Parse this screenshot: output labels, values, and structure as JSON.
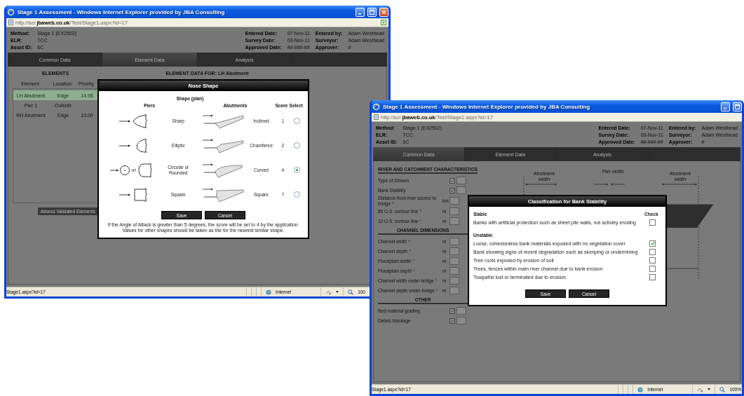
{
  "windows": [
    {
      "title": "Stage 1 Assessment - Windows Internet Explorer provided by JBA Consulting",
      "address": "http://scr.**jbaweb.co.uk**/Test/Stage1.aspx?id=17",
      "info_left": [
        {
          "label": "Method:",
          "value": "Stage 1 (EX2502)"
        },
        {
          "label": "ELR:",
          "value": "TCC"
        },
        {
          "label": "Asset ID:",
          "value": "6C"
        }
      ],
      "info_right": [
        {
          "label": "Entered Date:",
          "value": "07-Nov-11"
        },
        {
          "label": "Entered by:",
          "value": "Adam Westhead"
        },
        {
          "label": "Survey Date:",
          "value": "03-Nov-11"
        },
        {
          "label": "Surveyor:",
          "value": "Adam Westhead"
        },
        {
          "label": "Approved Date:",
          "value": "##-###-##"
        },
        {
          "label": "Approver:",
          "value": "#"
        }
      ],
      "tabs": [
        {
          "label": "Common Data",
          "selected": false
        },
        {
          "label": "Element Data",
          "selected": true
        },
        {
          "label": "Analysis",
          "selected": false
        }
      ],
      "kind": "elements",
      "elements": {
        "title": "ELEMENTS",
        "columns": [
          "Element",
          "Location",
          "Priority"
        ],
        "rows": [
          {
            "cells": [
              "LH Abutment",
              "Edge",
              "14.95"
            ],
            "selected": true
          },
          {
            "cells": [
              "Pier 1",
              "Outside"
            ],
            "selected": false
          },
          {
            "cells": [
              "RH Abutment",
              "Edge",
              "10.00"
            ],
            "selected": false
          }
        ],
        "button": "Assess Validated Elements"
      },
      "data_title": "ELEMENT DATA FOR:  LH Abutment",
      "dialog": {
        "kind": "nose_shape",
        "title": "Nose Shape",
        "heading": "Shape (plan)",
        "columns": [
          "Piers",
          "Abutments",
          "Score",
          "Select"
        ],
        "rows": [
          {
            "pier": {
              "kind": "sharp",
              "name": "Sharp"
            },
            "abutment": {
              "kind": "inclined",
              "name": "Inclined"
            },
            "score": "1",
            "selected": false
          },
          {
            "pier": {
              "kind": "elliptic",
              "name": "Elliptic"
            },
            "abutment": {
              "kind": "chamfered",
              "name": "Chamfered"
            },
            "score": "2",
            "selected": false
          },
          {
            "pier": {
              "kind": "circular",
              "name": "Circular or Rounded",
              "alt": "or"
            },
            "abutment": {
              "kind": "curved",
              "name": "Curved"
            },
            "score": "4",
            "selected": true
          },
          {
            "pier": {
              "kind": "square",
              "name": "Square"
            },
            "abutment": {
              "kind": "square",
              "name": "Square"
            },
            "score": "7",
            "selected": false
          }
        ],
        "buttons": [
          "Save",
          "Cancel"
        ],
        "notes": [
          "If the Angle of Attack is greater than 5 degrees, the score will be set to 4 by the application.",
          "Values for other shapes should be taken as the for the nearest similar shape."
        ]
      },
      "status": {
        "text": "Stage1.aspx?id=17",
        "zone": "Internet",
        "zoom": "100"
      }
    },
    {
      "title": "Stage 1 Assessment - Windows Internet Explorer provided by JBA Consulting",
      "address": "http://scr.**jbaweb.co.uk**/Test/Stage1.aspx?id=17",
      "info_left": [
        {
          "label": "Method:",
          "value": "Stage 1 (EX2502)"
        },
        {
          "label": "ELR:",
          "value": "TCC"
        },
        {
          "label": "Asset ID:",
          "value": "6C"
        }
      ],
      "info_right": [
        {
          "label": "Entered Date:",
          "value": "07-Nov-11"
        },
        {
          "label": "Entered by:",
          "value": "Adam Westhead"
        },
        {
          "label": "Survey Date:",
          "value": "03-Nov-11"
        },
        {
          "label": "Surveyor:",
          "value": "Adam Westhead"
        },
        {
          "label": "Approved Date:",
          "value": "##-###-##"
        },
        {
          "label": "Approver:",
          "value": "#"
        }
      ],
      "tabs": [
        {
          "label": "Common Data",
          "selected": true
        },
        {
          "label": "Element Data",
          "selected": false
        },
        {
          "label": "Analysis",
          "selected": false
        }
      ],
      "kind": "common",
      "sections": [
        {
          "heading": "RIVER AND CATCHMENT CHARACTERISTICS",
          "fields": [
            {
              "label": "Type of Stream",
              "kind": "select"
            },
            {
              "label": "Bank Stability",
              "kind": "select"
            },
            {
              "label": "Distance from river source to bridge",
              "required_mark": "*",
              "unit": "km",
              "kind": "number"
            },
            {
              "label": "85 O.S. contour line",
              "required_mark": "*",
              "unit": "m",
              "kind": "number"
            },
            {
              "label": "10 O.S. contour line",
              "required_mark": "*",
              "unit": "m",
              "kind": "number"
            }
          ]
        },
        {
          "heading": "CHANNEL DIMENSIONS",
          "fields": [
            {
              "label": "Channel width",
              "required_mark": "*",
              "unit": "m",
              "kind": "number"
            },
            {
              "label": "Channel depth",
              "required_mark": "*",
              "unit": "m",
              "kind": "number"
            },
            {
              "label": "Floodplain width",
              "required_mark": "*",
              "unit": "m",
              "kind": "number"
            },
            {
              "label": "Floodplain depth",
              "required_mark": "*",
              "unit": "m",
              "kind": "number"
            },
            {
              "label": "Channel width under bridge",
              "required_mark": "*",
              "unit": "m",
              "kind": "number"
            },
            {
              "label": "Channel depth under bridge",
              "required_mark": "*",
              "unit": "m",
              "kind": "number"
            }
          ]
        },
        {
          "heading": "OTHER",
          "fields": [
            {
              "label": "Bed material grading",
              "kind": "select"
            },
            {
              "label": "Debris blockage",
              "kind": "select"
            }
          ]
        }
      ],
      "diagram_labels": [
        "Abutment width",
        "Pier width",
        "Abutment width"
      ],
      "dialog": {
        "kind": "bank_stability",
        "title": "Classification for Bank Stability",
        "check_heading": "Check",
        "groups": [
          {
            "heading": "Stable",
            "items": [
              {
                "text": "Banks with artificial protection such as sheet pile walls, not activley eroding",
                "checked": false
              }
            ]
          },
          {
            "heading": "Unstable",
            "items": [
              {
                "text": "Loose, cohesionless bank materials exposed with no vegetation cover",
                "checked": true
              },
              {
                "text": "Bank showing signs of recent degradation such as slumping or undermining",
                "checked": false
              },
              {
                "text": "Tree roots exposed by erosion of soil",
                "checked": false
              },
              {
                "text": "Trees, fences within main river channel due to bank erosion",
                "checked": false
              },
              {
                "text": "Towpaths lost or terminated due to erosion",
                "checked": false
              }
            ]
          }
        ],
        "buttons": [
          "Save",
          "Cancel"
        ]
      },
      "status": {
        "text": "Stage1.aspx?id=17",
        "zone": "Internet",
        "zoom": "100%"
      }
    }
  ]
}
